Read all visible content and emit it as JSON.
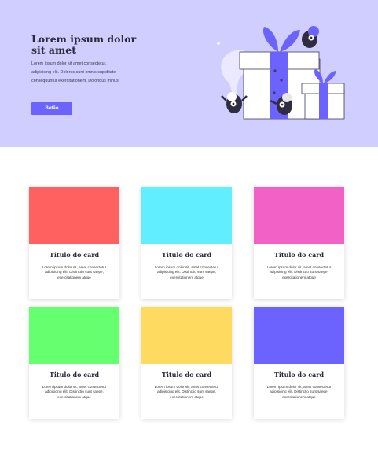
{
  "hero": {
    "title": "Lorem ipsum dolor sit amet",
    "text": "Lorem ipsum dolor sit amet consectetur, adipisicing elit. Dolores sunt omnis cupiditate consequuntur exercitationem, Doloribus minus.",
    "button_label": "Botão",
    "background_color": "#d0ceff",
    "accent_color": "#6c63ff"
  },
  "cards": [
    {
      "title": "Titulo do card",
      "text": "Lorem ipsum dolor sit, amet consectetur adipisicing elit. Distinctio sunt saepe, exercitationem atque",
      "color": "#ff6161"
    },
    {
      "title": "Titulo do card",
      "text": "Lorem ipsum dolor sit, amet consectetur adipisicing elit. Distinctio sunt saepe, exercitationem atque",
      "color": "#61eeff"
    },
    {
      "title": "Titulo do card",
      "text": "Lorem ipsum dolor sit, amet consectetur adipisicing elit. Distinctio sunt saepe, exercitationem atque",
      "color": "#f261c6"
    },
    {
      "title": "Titulo do card",
      "text": "Lorem ipsum dolor sit, amet consectetur adipisicing elit. Distinctio sunt saepe, exercitationem atque",
      "color": "#66ff70"
    },
    {
      "title": "Titulo do card",
      "text": "Lorem ipsum dolor sit, amet consectetur adipisicing elit. Distinctio sunt saepe, exercitationem atque",
      "color": "#ffda61"
    },
    {
      "title": "Titulo do card",
      "text": "Lorem ipsum dolor sit, amet consectetur adipisicing elit. Distinctio sunt saepe, exercitationem atque",
      "color": "#6c63ff"
    }
  ]
}
